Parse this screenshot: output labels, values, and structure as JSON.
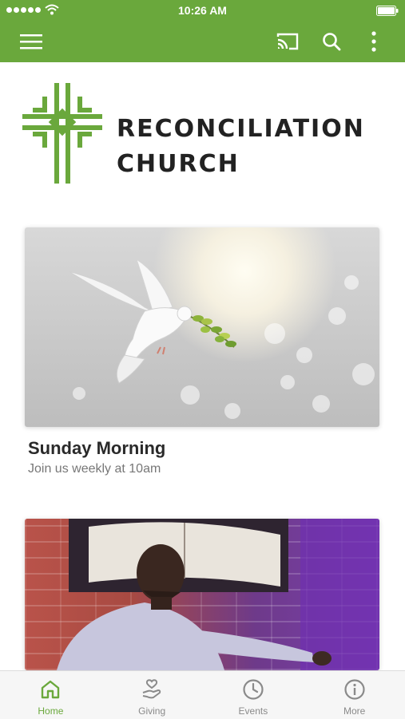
{
  "status_bar": {
    "time": "10:26 AM"
  },
  "header": {
    "menu_icon": "hamburger-menu-icon",
    "cast_icon": "cast-icon",
    "search_icon": "search-icon",
    "more_icon": "more-vertical-icon",
    "color": "#6aa83c"
  },
  "logo": {
    "line1": "RECONCILIATION",
    "line2": "CHURCH",
    "cross_color": "#6aa83c"
  },
  "cards": [
    {
      "title": "Sunday Morning",
      "subtitle": "Join us weekly at 10am",
      "image": "dove-with-olive-branch"
    },
    {
      "title": "",
      "subtitle": "",
      "image": "pastor-preaching"
    }
  ],
  "tabs": [
    {
      "label": "Home",
      "icon": "home-icon",
      "active": true
    },
    {
      "label": "Giving",
      "icon": "giving-hand-heart-icon",
      "active": false
    },
    {
      "label": "Events",
      "icon": "clock-icon",
      "active": false
    },
    {
      "label": "More",
      "icon": "info-icon",
      "active": false
    }
  ]
}
